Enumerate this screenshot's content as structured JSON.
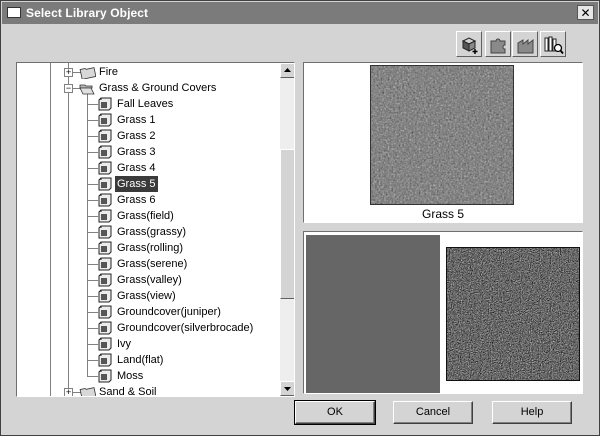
{
  "window": {
    "title": "Select Library Object",
    "close_glyph": "✕"
  },
  "toolbar": {
    "buttons": [
      {
        "name": "add-object-icon"
      },
      {
        "name": "puzzle-icon"
      },
      {
        "name": "factory-icon"
      },
      {
        "name": "library-search-icon"
      }
    ]
  },
  "tree": {
    "items": [
      {
        "label": "Fire",
        "level": 1,
        "type": "folder",
        "expander": "+"
      },
      {
        "label": "Grass & Ground Covers",
        "level": 1,
        "type": "folder",
        "expander": "-"
      },
      {
        "label": "Fall Leaves",
        "level": 2,
        "type": "object"
      },
      {
        "label": "Grass 1",
        "level": 2,
        "type": "object"
      },
      {
        "label": "Grass 2",
        "level": 2,
        "type": "object"
      },
      {
        "label": "Grass 3",
        "level": 2,
        "type": "object"
      },
      {
        "label": "Grass 4",
        "level": 2,
        "type": "object"
      },
      {
        "label": "Grass 5",
        "level": 2,
        "type": "object",
        "selected": true
      },
      {
        "label": "Grass 6",
        "level": 2,
        "type": "object"
      },
      {
        "label": "Grass(field)",
        "level": 2,
        "type": "object"
      },
      {
        "label": "Grass(grassy)",
        "level": 2,
        "type": "object"
      },
      {
        "label": "Grass(rolling)",
        "level": 2,
        "type": "object"
      },
      {
        "label": "Grass(serene)",
        "level": 2,
        "type": "object"
      },
      {
        "label": "Grass(valley)",
        "level": 2,
        "type": "object"
      },
      {
        "label": "Grass(view)",
        "level": 2,
        "type": "object"
      },
      {
        "label": "Groundcover(juniper)",
        "level": 2,
        "type": "object"
      },
      {
        "label": "Groundcover(silverbrocade)",
        "level": 2,
        "type": "object"
      },
      {
        "label": "Ivy",
        "level": 2,
        "type": "object"
      },
      {
        "label": "Land(flat)",
        "level": 2,
        "type": "object"
      },
      {
        "label": "Moss",
        "level": 2,
        "type": "object"
      },
      {
        "label": "Sand & Soil",
        "level": 1,
        "type": "folder",
        "expander": "+"
      }
    ]
  },
  "preview": {
    "caption": "Grass 5"
  },
  "colors": {
    "diffuse_swatch": "#666666",
    "selection": "#3a3a3a"
  },
  "buttons": {
    "ok": "OK",
    "cancel": "Cancel",
    "help": "Help"
  }
}
